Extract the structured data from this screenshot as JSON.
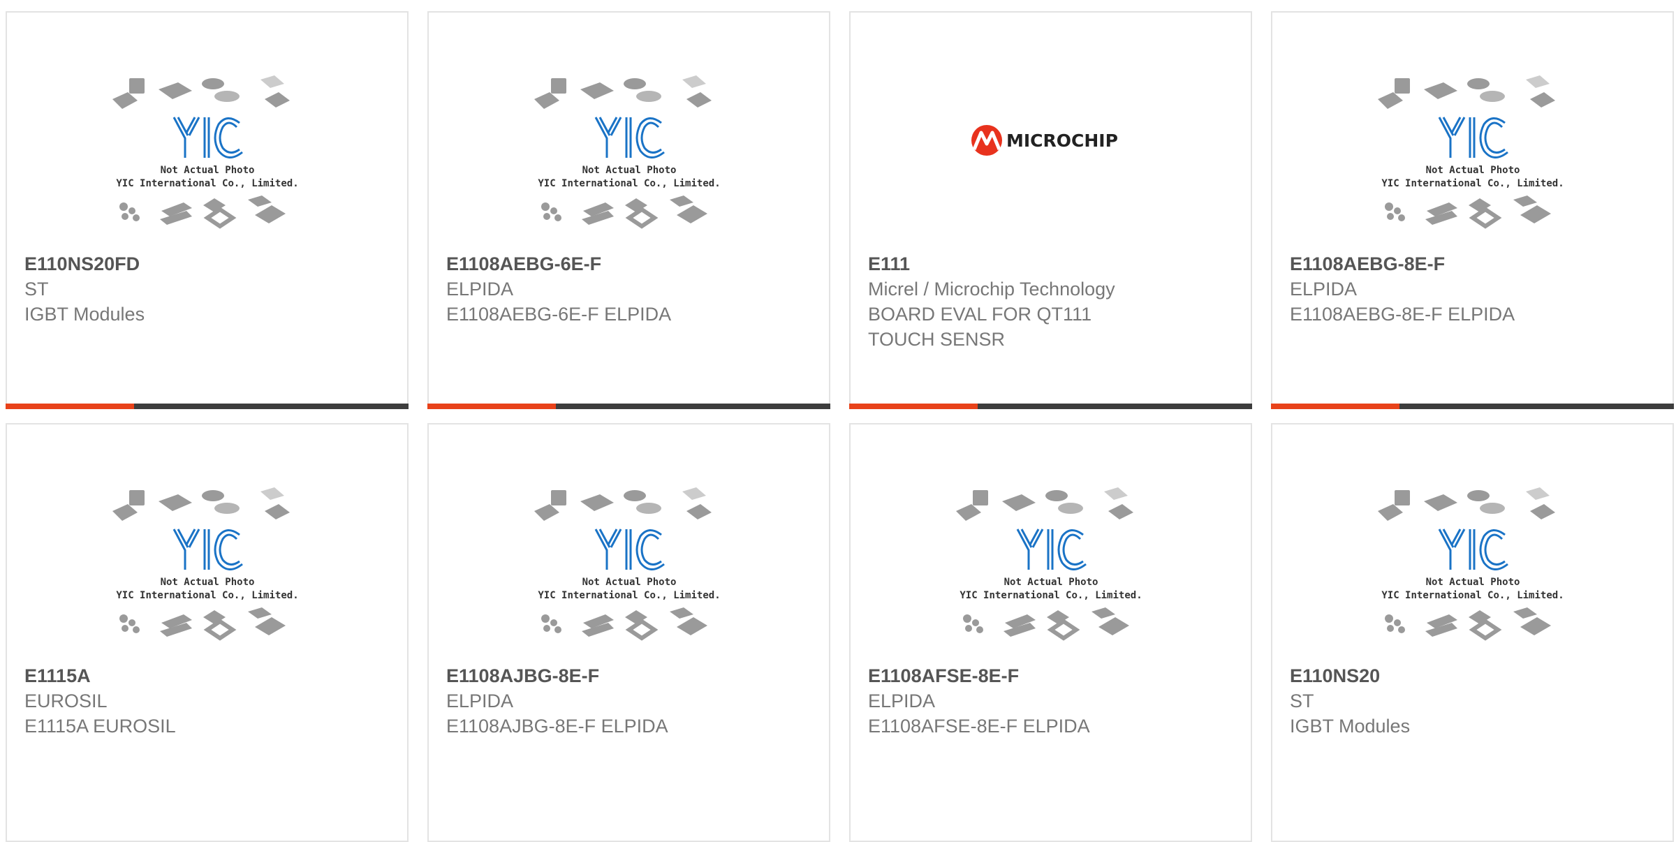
{
  "colors": {
    "accent": "#e8421a",
    "bar": "#3d3d3d",
    "logo_blue": "#1a73c6",
    "microchip_red": "#e8321d"
  },
  "placeholder": {
    "line1": "Not Actual Photo",
    "line2": "YIC International Co., Limited."
  },
  "microchip_logo_text": "MICROCHIP",
  "products": [
    {
      "part": "E110NS20FD",
      "maker": "ST",
      "desc": "IGBT Modules",
      "image": "yic-placeholder"
    },
    {
      "part": "E1108AEBG-6E-F",
      "maker": "ELPIDA",
      "desc": "E1108AEBG-6E-F ELPIDA",
      "image": "yic-placeholder"
    },
    {
      "part": "E111",
      "maker": "Micrel / Microchip Technology",
      "desc": "BOARD EVAL FOR QT111 TOUCH SENSR",
      "image": "microchip-logo"
    },
    {
      "part": "E1108AEBG-8E-F",
      "maker": "ELPIDA",
      "desc": "E1108AEBG-8E-F ELPIDA",
      "image": "yic-placeholder"
    },
    {
      "part": "E1115A",
      "maker": "EUROSIL",
      "desc": "E1115A EUROSIL",
      "image": "yic-placeholder"
    },
    {
      "part": "E1108AJBG-8E-F",
      "maker": "ELPIDA",
      "desc": "E1108AJBG-8E-F ELPIDA",
      "image": "yic-placeholder"
    },
    {
      "part": "E1108AFSE-8E-F",
      "maker": "ELPIDA",
      "desc": "E1108AFSE-8E-F ELPIDA",
      "image": "yic-placeholder"
    },
    {
      "part": "E110NS20",
      "maker": "ST",
      "desc": "IGBT Modules",
      "image": "yic-placeholder"
    }
  ]
}
